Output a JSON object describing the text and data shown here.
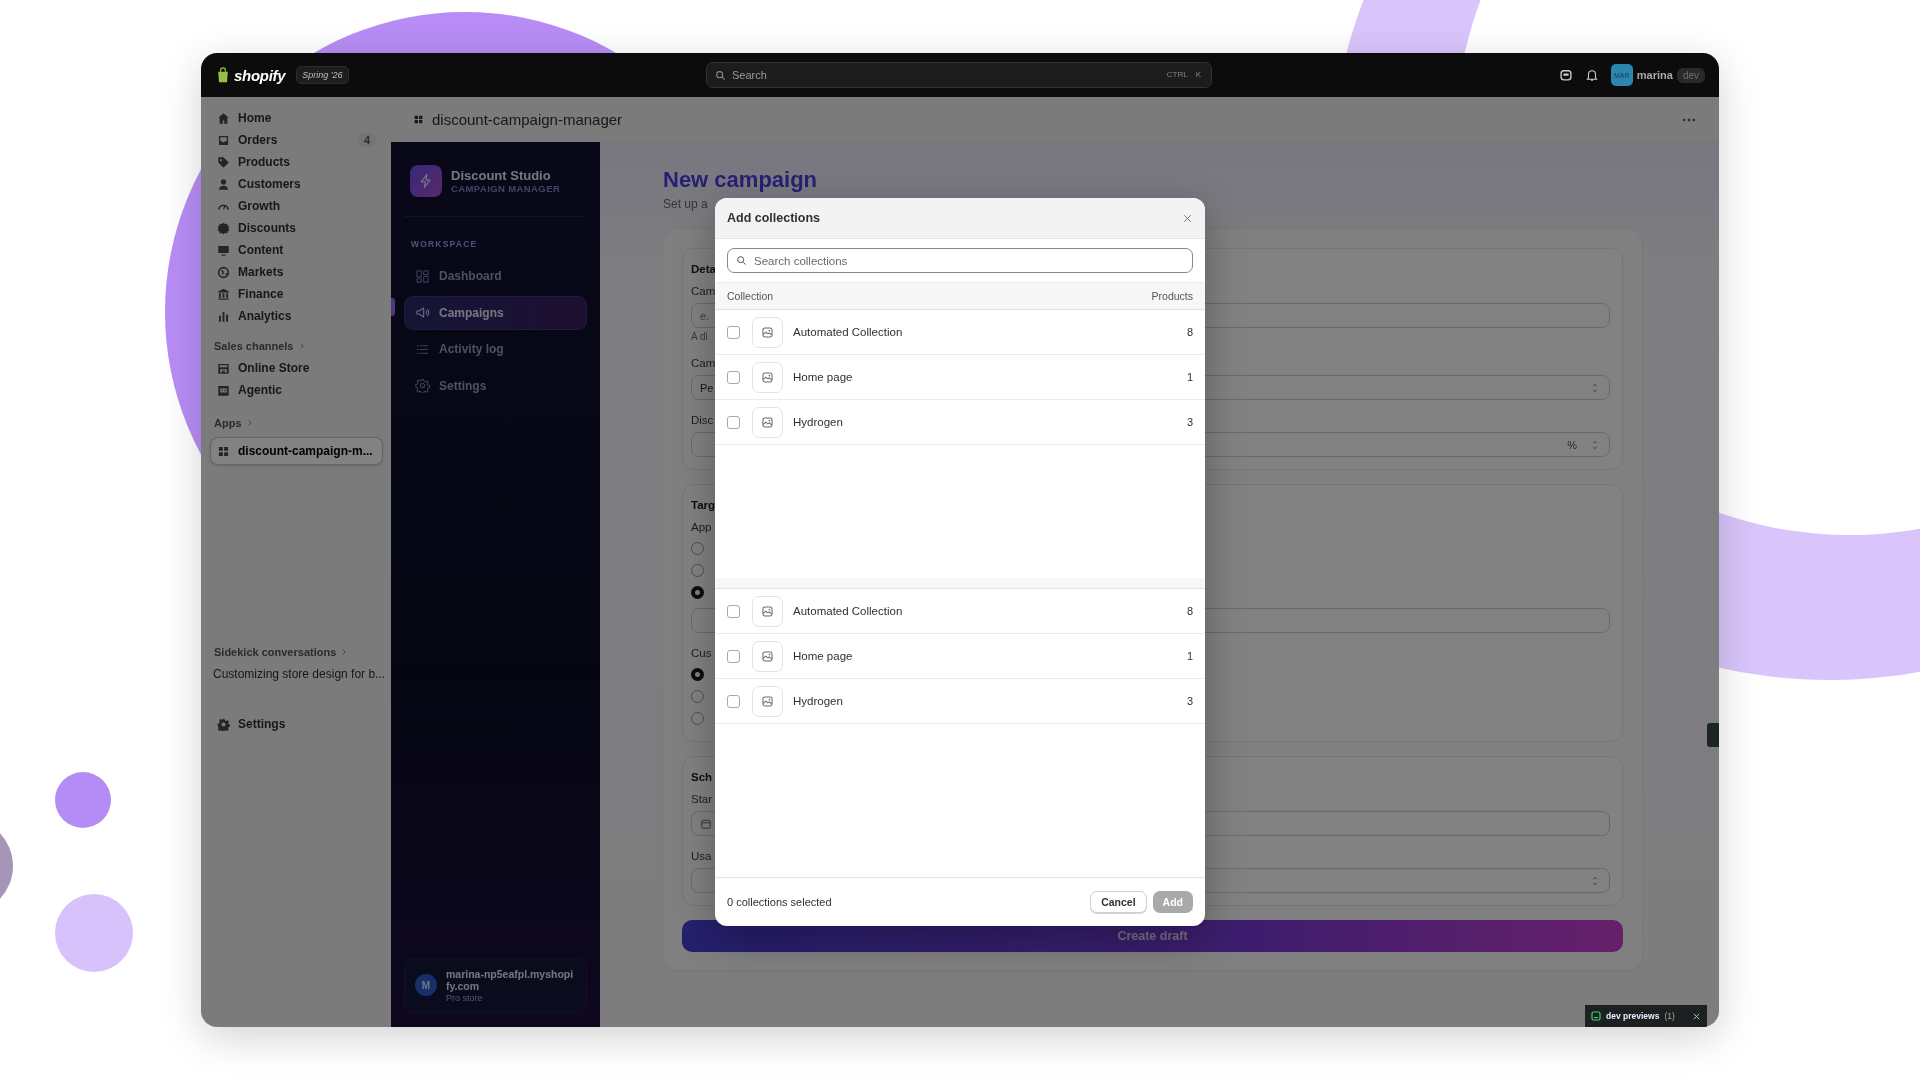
{
  "topbar": {
    "brand": "shopify",
    "edition": "Spring '26",
    "search": {
      "placeholder": "Search",
      "shortcut": [
        "CTRL",
        "K"
      ]
    },
    "user": {
      "initials": "MAR",
      "name": "marina",
      "badge": "dev"
    }
  },
  "sidebar": {
    "items": [
      {
        "label": "Home",
        "selected": false
      },
      {
        "label": "Orders",
        "badge": "4",
        "selected": false
      },
      {
        "label": "Products",
        "selected": false
      },
      {
        "label": "Customers",
        "selected": false
      },
      {
        "label": "Growth",
        "selected": false
      },
      {
        "label": "Discounts",
        "selected": false
      },
      {
        "label": "Content",
        "selected": false
      },
      {
        "label": "Markets",
        "selected": false
      },
      {
        "label": "Finance",
        "selected": false
      },
      {
        "label": "Analytics",
        "selected": false
      }
    ],
    "sections": [
      {
        "title": "Sales channels",
        "items": [
          {
            "label": "Online Store",
            "selected": false
          },
          {
            "label": "Agentic",
            "selected": false
          }
        ]
      },
      {
        "title": "Apps",
        "items": [
          {
            "label": "discount-campaign-m...",
            "selected": true
          }
        ]
      },
      {
        "title": "Sidekick conversations",
        "items": [
          {
            "label": "Customizing store design for b...",
            "selected": false
          }
        ]
      }
    ],
    "footer": {
      "label": "Settings"
    }
  },
  "app_header": {
    "title": "discount-campaign-manager"
  },
  "app_sidebar": {
    "brand": {
      "name": "Discount Studio",
      "tagline": "CAMPAIGN MANAGER"
    },
    "section": "WORKSPACE",
    "items": [
      {
        "label": "Dashboard",
        "selected": false
      },
      {
        "label": "Campaigns",
        "selected": true
      },
      {
        "label": "Activity log",
        "selected": false
      },
      {
        "label": "Settings",
        "selected": false
      }
    ],
    "store": {
      "initial": "M",
      "name": "marina-np5eafpl.myshopify.com",
      "plan": "Pro store"
    }
  },
  "page": {
    "title": "New campaign",
    "subtitle": "Set up a",
    "form": {
      "sections": [
        {
          "title": "Deta",
          "items": [
            {
              "kind": "label",
              "text": "Cam"
            },
            {
              "kind": "input",
              "placeholder": "e."
            },
            {
              "kind": "hint",
              "text": "A di"
            },
            {
              "kind": "label",
              "text": "Cam"
            },
            {
              "kind": "select",
              "value": "Pe"
            },
            {
              "kind": "label",
              "text": "Disc"
            },
            {
              "kind": "number",
              "suffix": "%"
            }
          ]
        },
        {
          "title": "Targ",
          "items": [
            {
              "kind": "label",
              "text": "App"
            },
            {
              "kind": "radios",
              "options": [
                {
                  "selected": false
                },
                {
                  "selected": false
                },
                {
                  "selected": true
                }
              ]
            },
            {
              "kind": "input"
            },
            {
              "kind": "label",
              "text": "Cus"
            },
            {
              "kind": "radios",
              "options": [
                {
                  "selected": true
                },
                {
                  "selected": false
                },
                {
                  "selected": false
                }
              ]
            }
          ]
        },
        {
          "title": "Sch",
          "items": [
            {
              "kind": "label",
              "text": "Star"
            },
            {
              "kind": "date"
            },
            {
              "kind": "label",
              "text": "Usa"
            },
            {
              "kind": "number"
            }
          ]
        }
      ],
      "submit": "Create draft"
    }
  },
  "modal": {
    "title": "Add collections",
    "search": {
      "placeholder": "Search collections"
    },
    "columns": [
      "Collection",
      "Products"
    ],
    "groups": [
      {
        "rows": [
          {
            "name": "Automated Collection",
            "products": "8",
            "checked": false
          },
          {
            "name": "Home page",
            "products": "1",
            "checked": false
          },
          {
            "name": "Hydrogen",
            "products": "3",
            "checked": false
          }
        ]
      },
      {
        "rows": [
          {
            "name": "Automated Collection",
            "products": "8",
            "checked": false
          },
          {
            "name": "Home page",
            "products": "1",
            "checked": false
          },
          {
            "name": "Hydrogen",
            "products": "3",
            "checked": false
          }
        ]
      }
    ],
    "footer": {
      "summary": "0 collections selected",
      "buttons": [
        {
          "label": "Cancel",
          "kind": "secondary",
          "disabled": false
        },
        {
          "label": "Add",
          "kind": "primary",
          "disabled": true
        }
      ]
    }
  },
  "dev_previews": {
    "label": "dev previews",
    "count": "(1)"
  }
}
